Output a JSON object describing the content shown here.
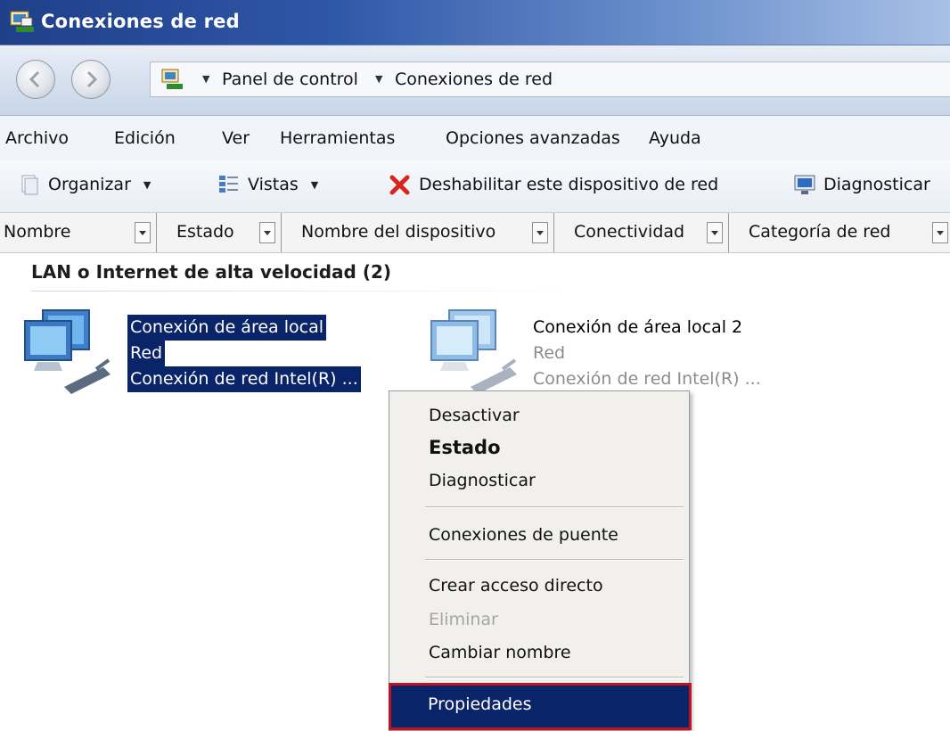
{
  "window": {
    "title": "Conexiones de red"
  },
  "address": {
    "crumbs": [
      "Panel de control",
      "Conexiones de red"
    ]
  },
  "menu": [
    "Archivo",
    "Edición",
    "Ver",
    "Herramientas",
    "Opciones avanzadas",
    "Ayuda"
  ],
  "toolbar": {
    "organize": "Organizar",
    "views": "Vistas",
    "disable": "Deshabilitar este dispositivo de red",
    "diagnose": "Diagnosticar"
  },
  "columns": [
    "Nombre",
    "Estado",
    "Nombre del dispositivo",
    "Conectividad",
    "Categoría de red"
  ],
  "group": {
    "title": "LAN o Internet de alta velocidad (2)"
  },
  "connections": [
    {
      "name": "Conexión de área local",
      "network": "Red",
      "device": "Conexión de red Intel(R) ...",
      "selected": true
    },
    {
      "name": "Conexión de área local 2",
      "network": "Red",
      "device": "Conexión de red Intel(R) ...",
      "selected": false
    }
  ],
  "context_menu": {
    "disable": "Desactivar",
    "status": "Estado",
    "diagnose": "Diagnosticar",
    "bridge": "Conexiones de puente",
    "shortcut": "Crear acceso directo",
    "delete": "Eliminar",
    "rename": "Cambiar nombre",
    "properties": "Propiedades"
  },
  "colors": {
    "title_bar": "#2f57a7",
    "selection": "#0a246a",
    "highlight_outline": "#c1121f",
    "menu_bg": "#f1f0ec"
  },
  "icons": {
    "window": "network-connections-icon",
    "back": "back-arrow-icon",
    "forward": "forward-arrow-icon",
    "disable": "red-x-icon",
    "views": "views-icon",
    "organize": "organize-icon",
    "diagnose": "diagnose-icon",
    "connection": "network-computer-icon"
  }
}
